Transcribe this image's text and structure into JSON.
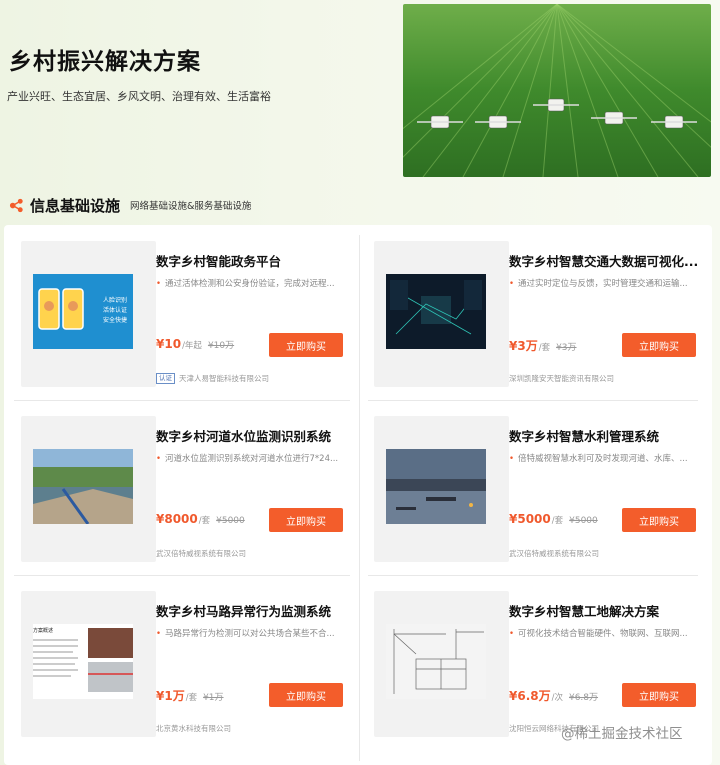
{
  "hero": {
    "title": "乡村振兴解决方案",
    "subtitle": "产业兴旺、生态宜居、乡风文明、治理有效、生活富裕"
  },
  "section": {
    "title": "信息基础设施",
    "subtitle": "网络基础设施&服务基础设施",
    "icon": "share-icon",
    "accent_color": "#f35d2b"
  },
  "products": [
    {
      "title": "数字乡村智能政务平台",
      "desc": "通过活体检测和公安身份验证，完成对远程...",
      "price": "¥10",
      "unit": "/年起",
      "orig_price": "¥10万",
      "buy_label": "立即购买",
      "vendor_badge": "认证",
      "vendor": "天津人易智能科技有限公司",
      "thumb_texts": [
        "人脸识别",
        "活体认证",
        "安全快捷"
      ]
    },
    {
      "title": "数字乡村智慧交通大数据可视化...",
      "desc": "通过实时定位与反馈，实时管理交通和运输...",
      "price": "¥3万",
      "unit": "/套",
      "orig_price": "¥3万",
      "buy_label": "立即购买",
      "vendor": "深圳凯隆安天智能资讯有限公司"
    },
    {
      "title": "数字乡村河道水位监测识别系统",
      "desc": "河道水位监测识别系统对河道水位进行7*24...",
      "price": "¥8000",
      "unit": "/套",
      "orig_price": "¥5000",
      "buy_label": "立即购买",
      "vendor": "武汉倍特威视系统有限公司"
    },
    {
      "title": "数字乡村智慧水利管理系统",
      "desc": "倍特威视智慧水利可及时发现河道、水库、...",
      "price": "¥5000",
      "unit": "/套",
      "orig_price": "¥5000",
      "buy_label": "立即购买",
      "vendor": "武汉倍特威视系统有限公司"
    },
    {
      "title": "数字乡村马路异常行为监测系统",
      "desc": "马路异常行为检测可以对公共场合某些不合...",
      "price": "¥1万",
      "unit": "/套",
      "orig_price": "¥1万",
      "buy_label": "立即购买",
      "vendor": "北京黄水科技有限公司",
      "thumb_texts": [
        "方案概述"
      ]
    },
    {
      "title": "数字乡村智慧工地解决方案",
      "desc": "可视化技术结合智能硬件、物联网、互联网...",
      "price": "¥6.8万",
      "unit": "/次",
      "orig_price": "¥6.8万",
      "buy_label": "立即购买",
      "vendor": "沈阳恒云网络科技有限公司"
    }
  ],
  "watermark": "@稀土掘金技术社区"
}
